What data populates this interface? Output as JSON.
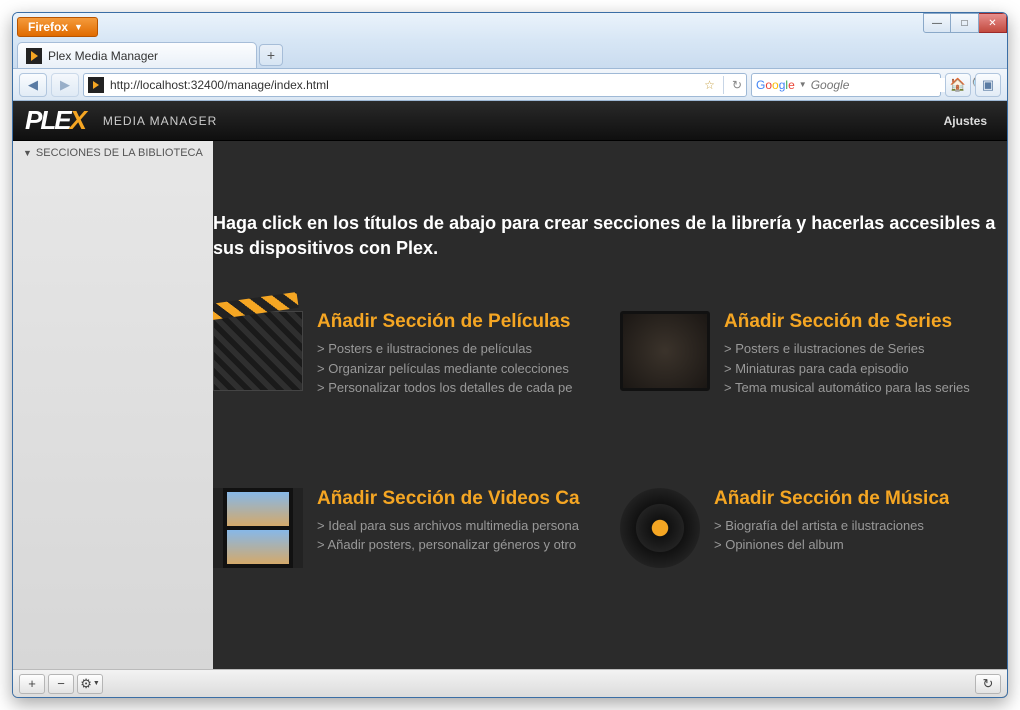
{
  "browser": {
    "name": "Firefox",
    "tab_title": "Plex Media Manager",
    "url": "http://localhost:32400/manage/index.html",
    "search_placeholder": "Google"
  },
  "plex": {
    "logo_main": "PLE",
    "logo_accent": "X",
    "subtitle": "MEDIA MANAGER",
    "settings": "Ajustes",
    "sidebar_header": "SECCIONES DE LA BIBLIOTECA",
    "intro": "Haga click en los títulos de abajo para crear secciones de la librería y hacerlas accesibles a sus dispositivos con Plex.",
    "sections": [
      {
        "title": "Añadir Sección de Películas",
        "bullets": [
          "> Posters e ilustraciones de películas",
          "> Organizar películas mediante colecciones",
          "> Personalizar todos los detalles de cada pe"
        ]
      },
      {
        "title": "Añadir Sección de Series",
        "bullets": [
          "> Posters e ilustraciones de Series",
          "> Miniaturas para cada episodio",
          "> Tema musical automático para las series"
        ]
      },
      {
        "title": "Añadir Sección de Videos Ca",
        "bullets": [
          "> Ideal para sus archivos multimedia persona",
          "> Añadir posters, personalizar géneros y otro"
        ]
      },
      {
        "title": "Añadir Sección de Música",
        "bullets": [
          "> Biografía del artista e ilustraciones",
          "> Opiniones del album"
        ]
      }
    ],
    "footer": {
      "add": "+",
      "remove": "−",
      "gear": "⚙",
      "refresh": "↻"
    }
  }
}
